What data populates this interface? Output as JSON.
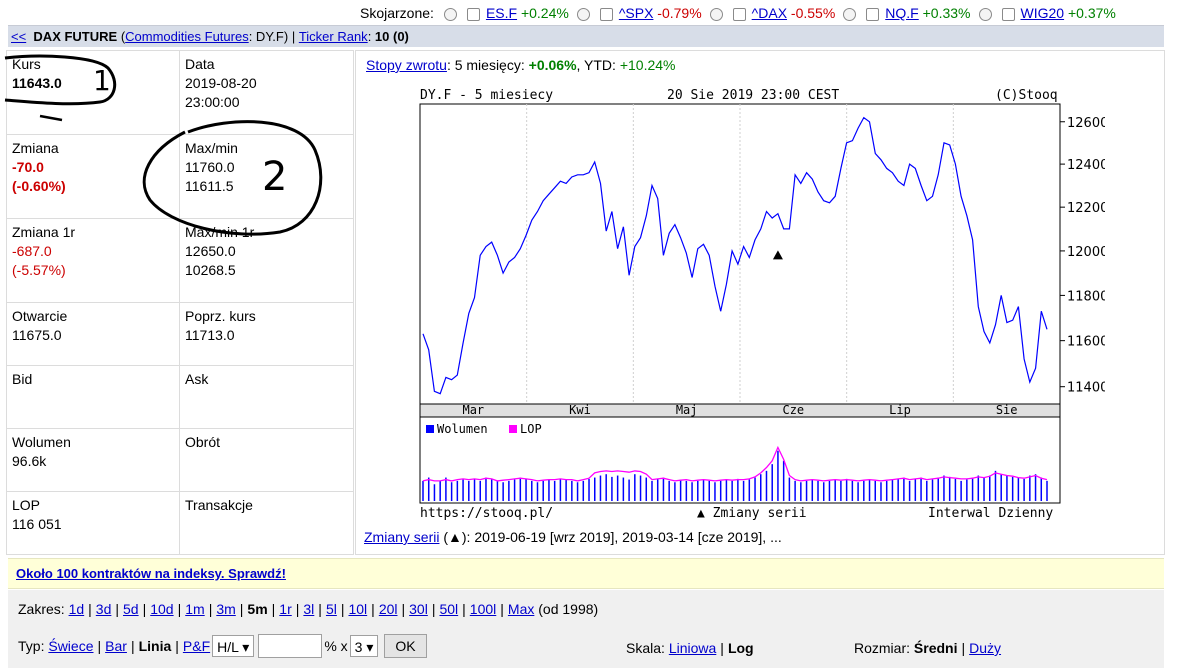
{
  "top": {
    "label": "Skojarzone:",
    "tickers": [
      {
        "sym": "ES.F",
        "chg": "+0.24%",
        "sign": "pos"
      },
      {
        "sym": "^SPX",
        "chg": "-0.79%",
        "sign": "neg"
      },
      {
        "sym": "^DAX",
        "chg": "-0.55%",
        "sign": "neg"
      },
      {
        "sym": "NQ.F",
        "chg": "+0.33%",
        "sign": "pos"
      },
      {
        "sym": "WIG20",
        "chg": "+0.37%",
        "sign": "pos"
      }
    ]
  },
  "header": {
    "back": "<<",
    "name": "DAX FUTURE",
    "category": "Commodities Futures",
    "symbol": ": DY.F)",
    "ticker_rank_label": "Ticker Rank",
    "rank": "10 (0)"
  },
  "quote": {
    "kurs_label": "Kurs",
    "kurs": "11643.0",
    "data_label": "Data",
    "date": "2019-08-20",
    "time": "23:00:00",
    "zmiana_label": "Zmiana",
    "zmiana": "-70.0",
    "zmiana_pct": "(-0.60%)",
    "maxmin_label": "Max/min",
    "max": "11760.0",
    "min": "11611.5",
    "zmiana1r_label": "Zmiana 1r",
    "zmiana1r": "-687.0",
    "zmiana1r_pct": "(-5.57%)",
    "maxmin1r_label": "Max/min 1r",
    "max1r": "12650.0",
    "min1r": "10268.5",
    "otwarcie_label": "Otwarcie",
    "otwarcie": "11675.0",
    "poprz_label": "Poprz. kurs",
    "poprz": "11713.0",
    "bid_label": "Bid",
    "ask_label": "Ask",
    "wolumen_label": "Wolumen",
    "wolumen": "96.6k",
    "obrot_label": "Obrót",
    "lop_label": "LOP",
    "lop": "116 051",
    "transakcje_label": "Transakcje"
  },
  "annotations": {
    "one": "1",
    "two": "2"
  },
  "returns": {
    "link": "Stopy zwrotu",
    "text1": ": 5 miesięcy: ",
    "value1": "+0.06%",
    "text2": ", YTD: ",
    "value2": "+10.24%"
  },
  "chart": {
    "title_left": "DY.F - 5 miesiecy",
    "title_mid": "20 Sie 2019 23:00 CEST",
    "title_right": "(C)Stooq",
    "footer_left": "https://stooq.pl/",
    "footer_mid": "▲ Zmiany serii",
    "footer_right": "Interwal Dzienny",
    "legend_vol": "Wolumen",
    "legend_lop": "LOP",
    "color_price": "#0000ff",
    "color_lop": "#ff00ff"
  },
  "chart_data": {
    "type": "line",
    "months": [
      "Mar",
      "Kwi",
      "Maj",
      "Cze",
      "Lip",
      "Sie"
    ],
    "yticks": [
      11400,
      11600,
      11800,
      12000,
      12200,
      12400,
      12600
    ],
    "ylim": [
      11330,
      12680
    ],
    "scale": "log",
    "price": [
      11630,
      11560,
      11380,
      11370,
      11440,
      11430,
      11450,
      11590,
      11720,
      11790,
      11980,
      12020,
      12040,
      11980,
      11900,
      11950,
      11970,
      12010,
      12070,
      12140,
      12180,
      12230,
      12260,
      12290,
      12320,
      12310,
      12340,
      12350,
      12350,
      12360,
      12410,
      12310,
      12090,
      12180,
      12010,
      12110,
      11890,
      12020,
      12060,
      12160,
      12300,
      12240,
      11980,
      12080,
      12120,
      12060,
      11990,
      11880,
      12010,
      12030,
      11980,
      11840,
      11730,
      11850,
      12000,
      11940,
      12020,
      11970,
      12050,
      12100,
      12180,
      12150,
      12170,
      12100,
      12100,
      12350,
      12310,
      12360,
      12330,
      12270,
      12230,
      12220,
      12250,
      12380,
      12500,
      12510,
      12570,
      12620,
      12600,
      12450,
      12420,
      12380,
      12360,
      12320,
      12300,
      12400,
      12380,
      12300,
      12230,
      12250,
      12350,
      12500,
      12490,
      12400,
      12250,
      12160,
      12050,
      11750,
      11640,
      11590,
      11670,
      11800,
      11680,
      11690,
      11750,
      11520,
      11420,
      11480,
      11730,
      11650
    ],
    "volume_rel": [
      0.3,
      0.35,
      0.25,
      0.3,
      0.35,
      0.28,
      0.3,
      0.32,
      0.3,
      0.33,
      0.3,
      0.35,
      0.32,
      0.3,
      0.28,
      0.3,
      0.32,
      0.35,
      0.33,
      0.3,
      0.28,
      0.3,
      0.32,
      0.3,
      0.33,
      0.32,
      0.3,
      0.28,
      0.3,
      0.33,
      0.35,
      0.38,
      0.4,
      0.36,
      0.38,
      0.35,
      0.32,
      0.4,
      0.38,
      0.35,
      0.3,
      0.33,
      0.35,
      0.3,
      0.28,
      0.32,
      0.3,
      0.28,
      0.3,
      0.32,
      0.3,
      0.28,
      0.3,
      0.32,
      0.3,
      0.33,
      0.3,
      0.32,
      0.35,
      0.4,
      0.45,
      0.55,
      0.75,
      0.6,
      0.35,
      0.3,
      0.28,
      0.3,
      0.32,
      0.3,
      0.28,
      0.3,
      0.32,
      0.3,
      0.33,
      0.3,
      0.28,
      0.3,
      0.32,
      0.3,
      0.28,
      0.3,
      0.32,
      0.33,
      0.35,
      0.3,
      0.33,
      0.35,
      0.3,
      0.32,
      0.35,
      0.38,
      0.36,
      0.33,
      0.3,
      0.32,
      0.35,
      0.38,
      0.35,
      0.38,
      0.45,
      0.4,
      0.38,
      0.36,
      0.35,
      0.33,
      0.38,
      0.4,
      0.35,
      0.3
    ],
    "lop_rel": [
      0.3,
      0.32,
      0.3,
      0.3,
      0.32,
      0.3,
      0.32,
      0.33,
      0.32,
      0.33,
      0.32,
      0.34,
      0.33,
      0.3,
      0.31,
      0.32,
      0.33,
      0.34,
      0.33,
      0.32,
      0.3,
      0.31,
      0.32,
      0.32,
      0.33,
      0.32,
      0.32,
      0.3,
      0.32,
      0.34,
      0.42,
      0.44,
      0.45,
      0.44,
      0.45,
      0.44,
      0.43,
      0.45,
      0.44,
      0.4,
      0.32,
      0.33,
      0.34,
      0.32,
      0.3,
      0.31,
      0.32,
      0.3,
      0.31,
      0.32,
      0.31,
      0.3,
      0.31,
      0.32,
      0.31,
      0.32,
      0.32,
      0.33,
      0.36,
      0.42,
      0.5,
      0.6,
      0.8,
      0.62,
      0.38,
      0.32,
      0.3,
      0.31,
      0.32,
      0.31,
      0.3,
      0.31,
      0.32,
      0.31,
      0.32,
      0.31,
      0.3,
      0.31,
      0.32,
      0.31,
      0.3,
      0.31,
      0.32,
      0.33,
      0.34,
      0.32,
      0.33,
      0.34,
      0.32,
      0.33,
      0.34,
      0.36,
      0.35,
      0.34,
      0.33,
      0.33,
      0.34,
      0.36,
      0.35,
      0.37,
      0.42,
      0.4,
      0.38,
      0.37,
      0.35,
      0.34,
      0.36,
      0.38,
      0.34,
      0.32
    ],
    "marker": {
      "index": 62,
      "value": 11980
    }
  },
  "zmiany": {
    "link": "Zmiany serii",
    "text": " (▲): 2019-06-19 [wrz 2019], 2019-03-14 [cze 2019], ..."
  },
  "banner": {
    "text": "Około 100 kontraktów na indeksy. Sprawdź!"
  },
  "zakres": {
    "label": "Zakres:",
    "items": [
      "1d",
      "3d",
      "5d",
      "10d",
      "1m",
      "3m",
      "5m",
      "1r",
      "3l",
      "5l",
      "10l",
      "20l",
      "30l",
      "50l",
      "100l",
      "Max"
    ],
    "current": "5m",
    "suffix": "(od 1998)"
  },
  "typ": {
    "label": "Typ:",
    "items": [
      "Świece",
      "Bar",
      "Linia",
      "P&F"
    ],
    "current": "Linia",
    "select1": "H/L",
    "pct": "% x",
    "select2": "3",
    "ok": "OK"
  },
  "skala": {
    "label": "Skala:",
    "items": [
      "Liniowa",
      "Log"
    ],
    "current": "Log"
  },
  "rozmiar": {
    "label": "Rozmiar:",
    "items": [
      "Średni",
      "Duży"
    ],
    "current": "Średni"
  }
}
